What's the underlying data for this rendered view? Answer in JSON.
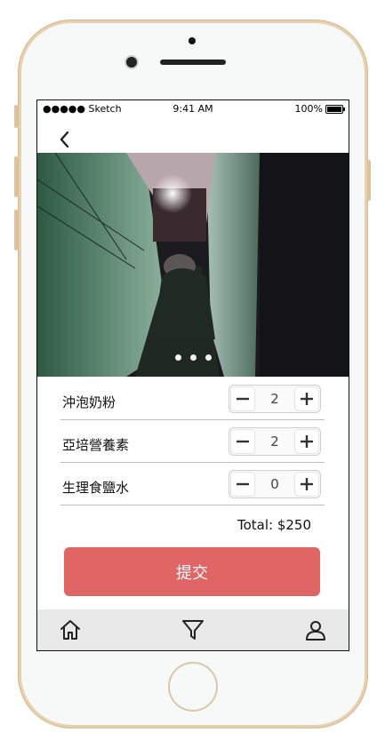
{
  "status_bar": {
    "signal": "●●●●● Sketch",
    "time": "9:41 AM",
    "battery": "100%"
  },
  "hero": {
    "slide_count": 3
  },
  "items": [
    {
      "name": "沖泡奶粉",
      "qty": "2"
    },
    {
      "name": "亞培營養素",
      "qty": "2"
    },
    {
      "name": "生理食鹽水",
      "qty": "0"
    }
  ],
  "total": "Total: $250",
  "submit_label": "提交",
  "tabbar": {
    "icons": [
      "home-icon",
      "filter-icon",
      "profile-icon"
    ]
  },
  "colors": {
    "accent": "#e06565",
    "tabbar_bg": "#e8e8e8"
  }
}
